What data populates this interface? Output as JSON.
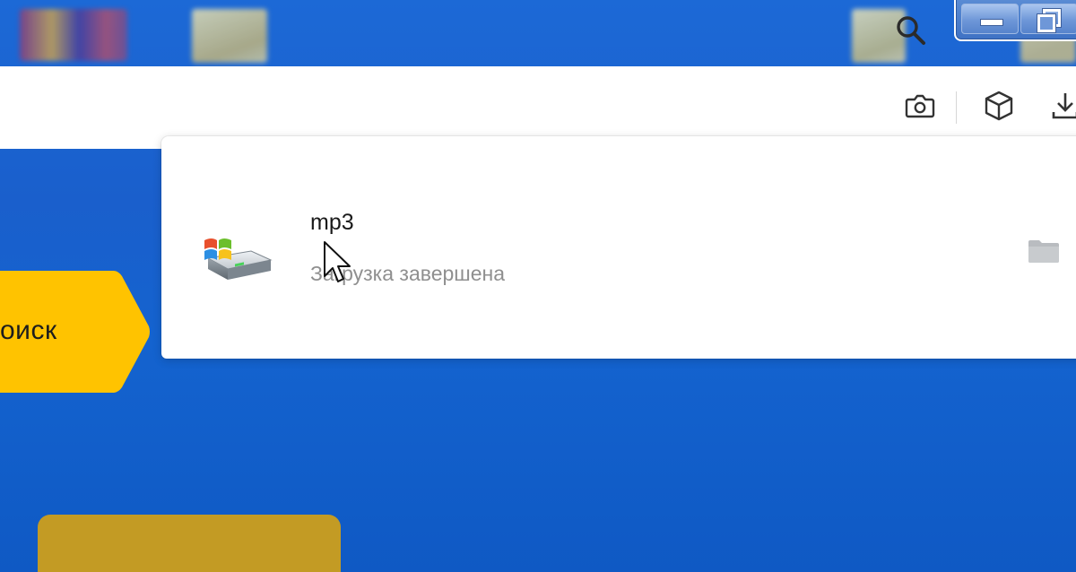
{
  "desktop": {
    "icons": [
      "archive-file-icon",
      "folder-icon",
      "folder-icon",
      "folder-icon"
    ]
  },
  "window_controls": {
    "minimize_icon": "minimize-icon",
    "restore_icon": "restore-icon"
  },
  "toolbar": {
    "search_icon": "search-icon",
    "screenshot_icon": "camera-icon",
    "extensions_icon": "cube-icon",
    "downloads_icon": "download-icon"
  },
  "search_tag": {
    "label": "оиск"
  },
  "downloads": {
    "items": [
      {
        "name": "mp3",
        "status": "Загрузка завершена",
        "icon": "drive-icon",
        "action_icon": "folder-icon"
      }
    ]
  },
  "colors": {
    "desktop_blue": "#1a5fcc",
    "tag_yellow": "#ffc300",
    "card_gold": "#c39b24",
    "status_gray": "#8f8f8f"
  }
}
